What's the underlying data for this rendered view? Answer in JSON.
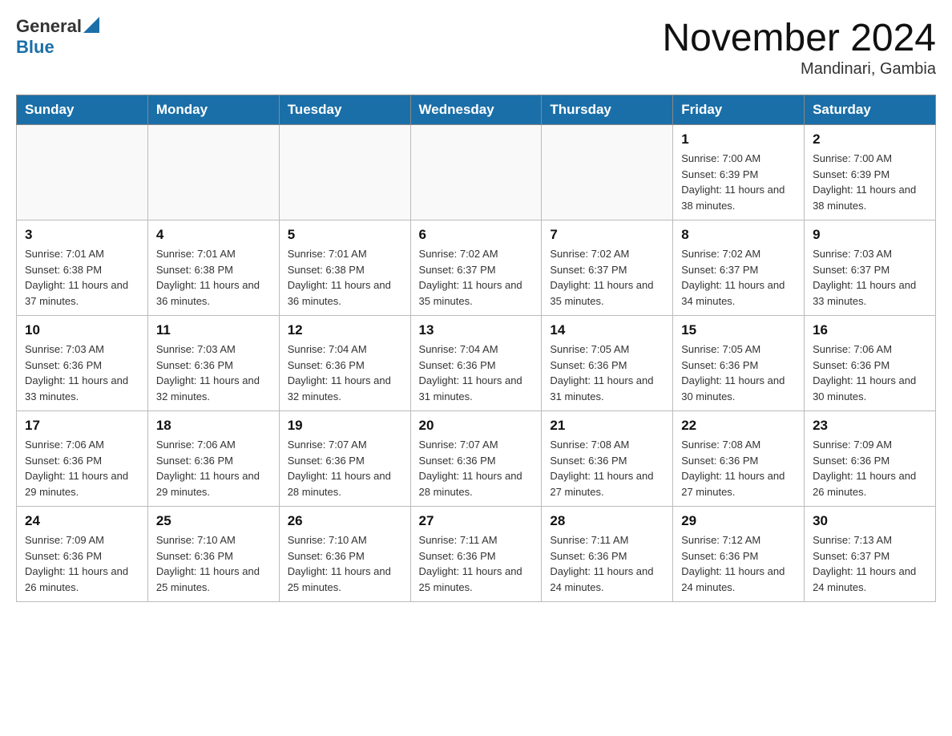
{
  "header": {
    "logo_general": "General",
    "logo_blue": "Blue",
    "month_title": "November 2024",
    "location": "Mandinari, Gambia"
  },
  "days_of_week": [
    "Sunday",
    "Monday",
    "Tuesday",
    "Wednesday",
    "Thursday",
    "Friday",
    "Saturday"
  ],
  "weeks": [
    [
      {
        "day": "",
        "sunrise": "",
        "sunset": "",
        "daylight": ""
      },
      {
        "day": "",
        "sunrise": "",
        "sunset": "",
        "daylight": ""
      },
      {
        "day": "",
        "sunrise": "",
        "sunset": "",
        "daylight": ""
      },
      {
        "day": "",
        "sunrise": "",
        "sunset": "",
        "daylight": ""
      },
      {
        "day": "",
        "sunrise": "",
        "sunset": "",
        "daylight": ""
      },
      {
        "day": "1",
        "sunrise": "Sunrise: 7:00 AM",
        "sunset": "Sunset: 6:39 PM",
        "daylight": "Daylight: 11 hours and 38 minutes."
      },
      {
        "day": "2",
        "sunrise": "Sunrise: 7:00 AM",
        "sunset": "Sunset: 6:39 PM",
        "daylight": "Daylight: 11 hours and 38 minutes."
      }
    ],
    [
      {
        "day": "3",
        "sunrise": "Sunrise: 7:01 AM",
        "sunset": "Sunset: 6:38 PM",
        "daylight": "Daylight: 11 hours and 37 minutes."
      },
      {
        "day": "4",
        "sunrise": "Sunrise: 7:01 AM",
        "sunset": "Sunset: 6:38 PM",
        "daylight": "Daylight: 11 hours and 36 minutes."
      },
      {
        "day": "5",
        "sunrise": "Sunrise: 7:01 AM",
        "sunset": "Sunset: 6:38 PM",
        "daylight": "Daylight: 11 hours and 36 minutes."
      },
      {
        "day": "6",
        "sunrise": "Sunrise: 7:02 AM",
        "sunset": "Sunset: 6:37 PM",
        "daylight": "Daylight: 11 hours and 35 minutes."
      },
      {
        "day": "7",
        "sunrise": "Sunrise: 7:02 AM",
        "sunset": "Sunset: 6:37 PM",
        "daylight": "Daylight: 11 hours and 35 minutes."
      },
      {
        "day": "8",
        "sunrise": "Sunrise: 7:02 AM",
        "sunset": "Sunset: 6:37 PM",
        "daylight": "Daylight: 11 hours and 34 minutes."
      },
      {
        "day": "9",
        "sunrise": "Sunrise: 7:03 AM",
        "sunset": "Sunset: 6:37 PM",
        "daylight": "Daylight: 11 hours and 33 minutes."
      }
    ],
    [
      {
        "day": "10",
        "sunrise": "Sunrise: 7:03 AM",
        "sunset": "Sunset: 6:36 PM",
        "daylight": "Daylight: 11 hours and 33 minutes."
      },
      {
        "day": "11",
        "sunrise": "Sunrise: 7:03 AM",
        "sunset": "Sunset: 6:36 PM",
        "daylight": "Daylight: 11 hours and 32 minutes."
      },
      {
        "day": "12",
        "sunrise": "Sunrise: 7:04 AM",
        "sunset": "Sunset: 6:36 PM",
        "daylight": "Daylight: 11 hours and 32 minutes."
      },
      {
        "day": "13",
        "sunrise": "Sunrise: 7:04 AM",
        "sunset": "Sunset: 6:36 PM",
        "daylight": "Daylight: 11 hours and 31 minutes."
      },
      {
        "day": "14",
        "sunrise": "Sunrise: 7:05 AM",
        "sunset": "Sunset: 6:36 PM",
        "daylight": "Daylight: 11 hours and 31 minutes."
      },
      {
        "day": "15",
        "sunrise": "Sunrise: 7:05 AM",
        "sunset": "Sunset: 6:36 PM",
        "daylight": "Daylight: 11 hours and 30 minutes."
      },
      {
        "day": "16",
        "sunrise": "Sunrise: 7:06 AM",
        "sunset": "Sunset: 6:36 PM",
        "daylight": "Daylight: 11 hours and 30 minutes."
      }
    ],
    [
      {
        "day": "17",
        "sunrise": "Sunrise: 7:06 AM",
        "sunset": "Sunset: 6:36 PM",
        "daylight": "Daylight: 11 hours and 29 minutes."
      },
      {
        "day": "18",
        "sunrise": "Sunrise: 7:06 AM",
        "sunset": "Sunset: 6:36 PM",
        "daylight": "Daylight: 11 hours and 29 minutes."
      },
      {
        "day": "19",
        "sunrise": "Sunrise: 7:07 AM",
        "sunset": "Sunset: 6:36 PM",
        "daylight": "Daylight: 11 hours and 28 minutes."
      },
      {
        "day": "20",
        "sunrise": "Sunrise: 7:07 AM",
        "sunset": "Sunset: 6:36 PM",
        "daylight": "Daylight: 11 hours and 28 minutes."
      },
      {
        "day": "21",
        "sunrise": "Sunrise: 7:08 AM",
        "sunset": "Sunset: 6:36 PM",
        "daylight": "Daylight: 11 hours and 27 minutes."
      },
      {
        "day": "22",
        "sunrise": "Sunrise: 7:08 AM",
        "sunset": "Sunset: 6:36 PM",
        "daylight": "Daylight: 11 hours and 27 minutes."
      },
      {
        "day": "23",
        "sunrise": "Sunrise: 7:09 AM",
        "sunset": "Sunset: 6:36 PM",
        "daylight": "Daylight: 11 hours and 26 minutes."
      }
    ],
    [
      {
        "day": "24",
        "sunrise": "Sunrise: 7:09 AM",
        "sunset": "Sunset: 6:36 PM",
        "daylight": "Daylight: 11 hours and 26 minutes."
      },
      {
        "day": "25",
        "sunrise": "Sunrise: 7:10 AM",
        "sunset": "Sunset: 6:36 PM",
        "daylight": "Daylight: 11 hours and 25 minutes."
      },
      {
        "day": "26",
        "sunrise": "Sunrise: 7:10 AM",
        "sunset": "Sunset: 6:36 PM",
        "daylight": "Daylight: 11 hours and 25 minutes."
      },
      {
        "day": "27",
        "sunrise": "Sunrise: 7:11 AM",
        "sunset": "Sunset: 6:36 PM",
        "daylight": "Daylight: 11 hours and 25 minutes."
      },
      {
        "day": "28",
        "sunrise": "Sunrise: 7:11 AM",
        "sunset": "Sunset: 6:36 PM",
        "daylight": "Daylight: 11 hours and 24 minutes."
      },
      {
        "day": "29",
        "sunrise": "Sunrise: 7:12 AM",
        "sunset": "Sunset: 6:36 PM",
        "daylight": "Daylight: 11 hours and 24 minutes."
      },
      {
        "day": "30",
        "sunrise": "Sunrise: 7:13 AM",
        "sunset": "Sunset: 6:37 PM",
        "daylight": "Daylight: 11 hours and 24 minutes."
      }
    ]
  ]
}
